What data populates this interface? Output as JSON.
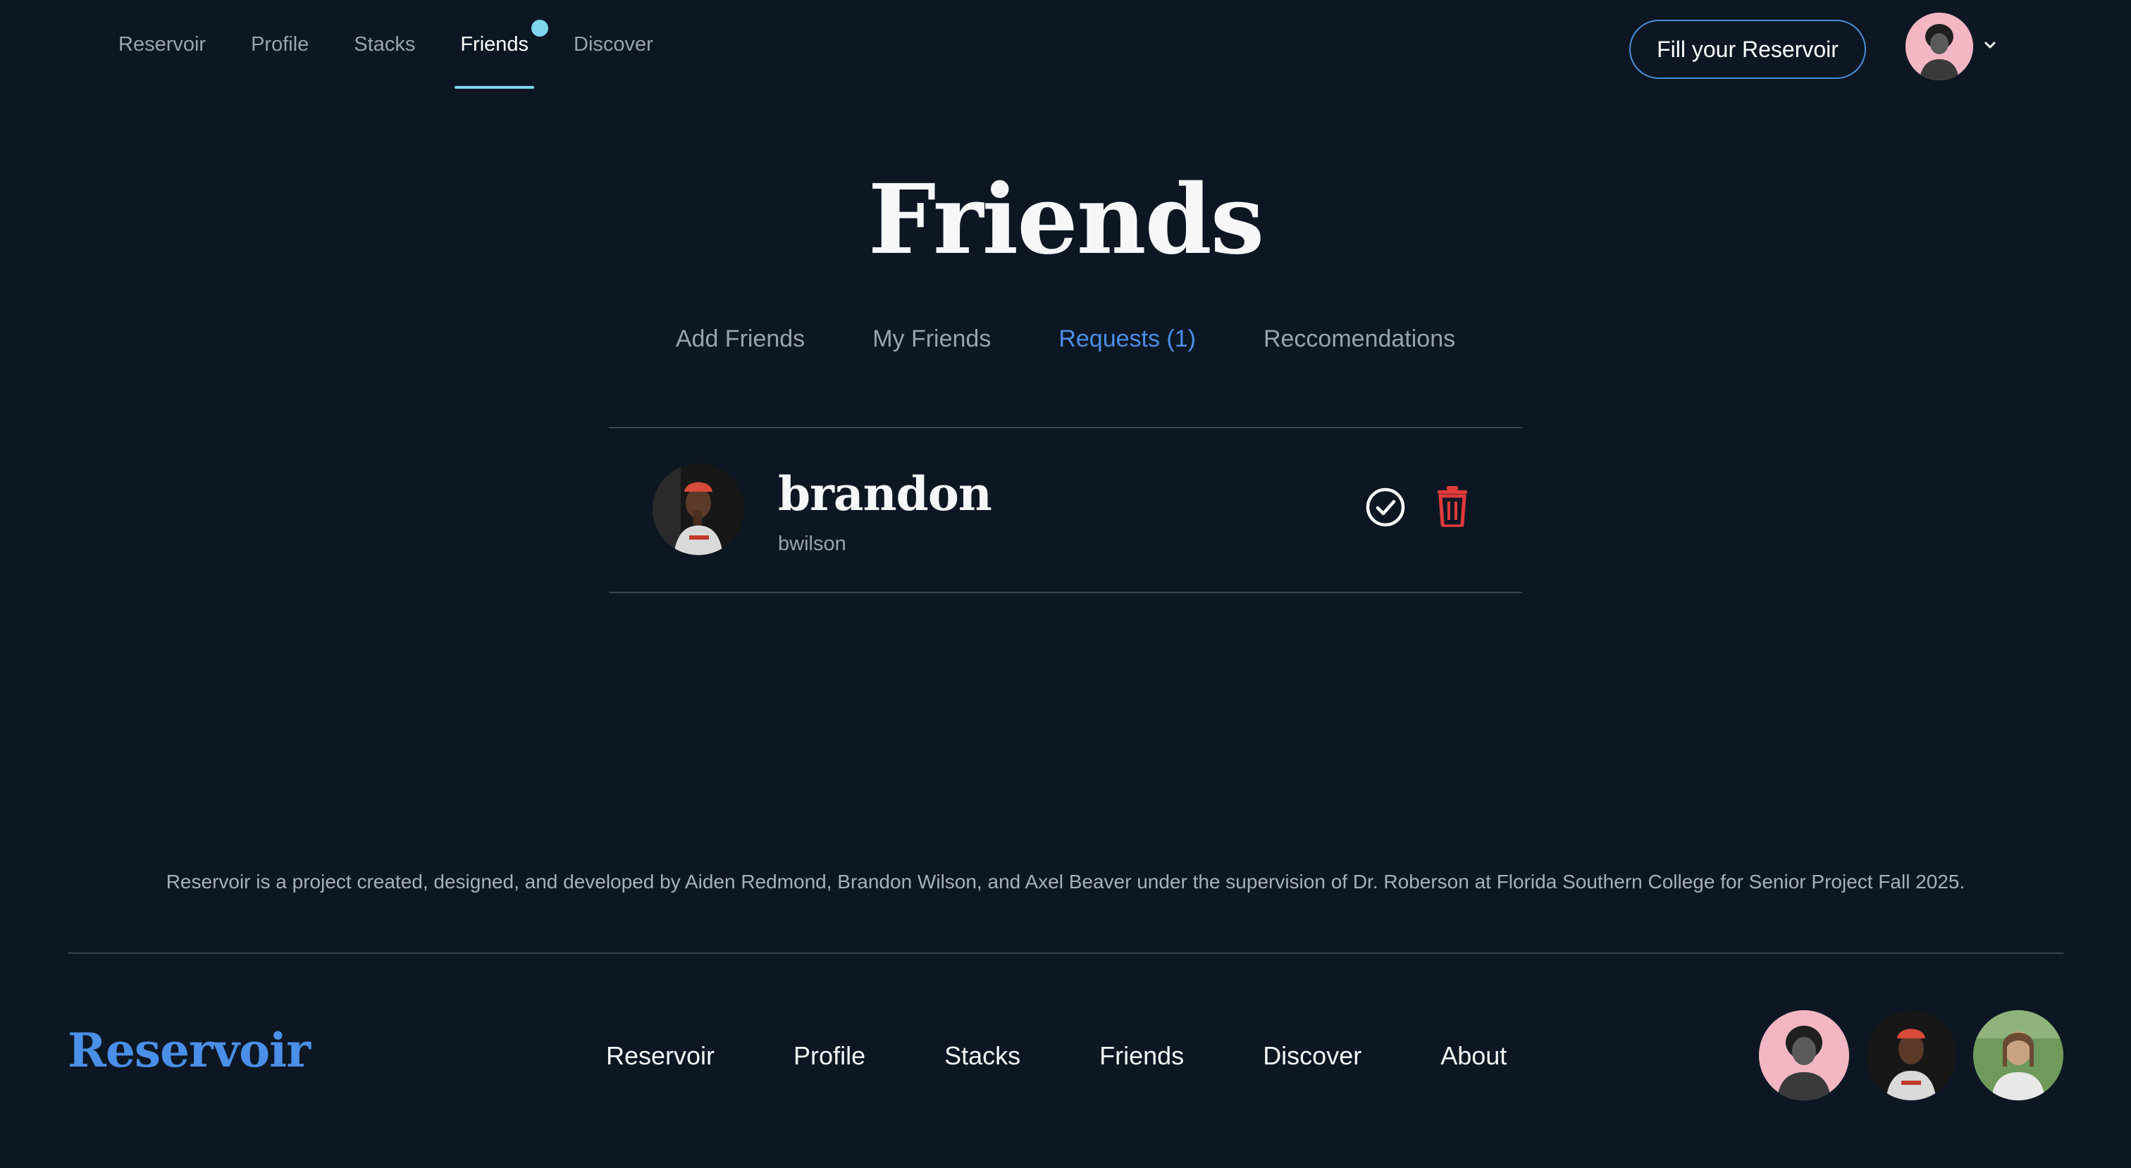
{
  "nav": {
    "links": [
      {
        "label": "Reservoir"
      },
      {
        "label": "Profile"
      },
      {
        "label": "Stacks"
      },
      {
        "label": "Friends",
        "active": true,
        "notification": true
      },
      {
        "label": "Discover"
      }
    ],
    "cta_label": "Fill your Reservoir",
    "accent_color": "#7fd6ee"
  },
  "page": {
    "title": "Friends",
    "tabs": [
      {
        "label": "Add Friends"
      },
      {
        "label": "My Friends"
      },
      {
        "label": "Requests (1)",
        "active": true
      },
      {
        "label": "Reccomendations"
      }
    ]
  },
  "requests": [
    {
      "name": "brandon",
      "username": "bwilson",
      "accept_icon": "check-circle-icon",
      "delete_icon": "trash-icon"
    }
  ],
  "footer": {
    "credits": "Reservoir is a project created, designed, and developed by Aiden Redmond, Brandon Wilson, and Axel Beaver under the supervision of Dr. Roberson at Florida Southern College for Senior Project Fall 2025.",
    "brand": "Reservoir",
    "links": [
      "Reservoir",
      "Profile",
      "Stacks",
      "Friends",
      "Discover",
      "About"
    ]
  },
  "colors": {
    "background": "#0c1723",
    "link_active": "#4a8fe8",
    "delete": "#e03a3a"
  }
}
